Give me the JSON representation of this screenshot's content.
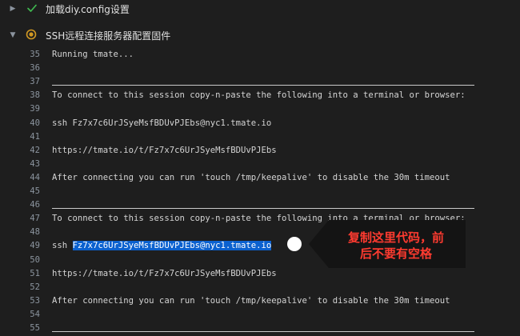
{
  "steps": [
    {
      "title": "加载diy.config设置",
      "status": "success",
      "icon": "check-icon"
    },
    {
      "title": "SSH远程连接服务器配置固件",
      "status": "running",
      "icon": "running-icon"
    }
  ],
  "log_lines": [
    {
      "n": "35",
      "text": "Running tmate..."
    },
    {
      "n": "36",
      "text": ""
    },
    {
      "n": "37",
      "text": "",
      "rule": true
    },
    {
      "n": "38",
      "text": "To connect to this session copy-n-paste the following into a terminal or browser:"
    },
    {
      "n": "39",
      "text": ""
    },
    {
      "n": "40",
      "text": "ssh Fz7x7c6UrJSyeMsfBDUvPJEbs@nyc1.tmate.io"
    },
    {
      "n": "41",
      "text": ""
    },
    {
      "n": "42",
      "text": "https://tmate.io/t/Fz7x7c6UrJSyeMsfBDUvPJEbs"
    },
    {
      "n": "43",
      "text": ""
    },
    {
      "n": "44",
      "text": "After connecting you can run 'touch /tmp/keepalive' to disable the 30m timeout"
    },
    {
      "n": "45",
      "text": ""
    },
    {
      "n": "46",
      "text": "",
      "rule": true
    },
    {
      "n": "47",
      "text": "To connect to this session copy-n-paste the following into a terminal or browser:"
    },
    {
      "n": "48",
      "text": ""
    },
    {
      "n": "49",
      "prefix": "ssh ",
      "highlight": "Fz7x7c6UrJSyeMsfBDUvPJEbs@nyc1.tmate.io"
    },
    {
      "n": "50",
      "text": ""
    },
    {
      "n": "51",
      "text": "https://tmate.io/t/Fz7x7c6UrJSyeMsfBDUvPJEbs"
    },
    {
      "n": "52",
      "text": ""
    },
    {
      "n": "53",
      "text": "After connecting you can run 'touch /tmp/keepalive' to disable the 30m timeout"
    },
    {
      "n": "54",
      "text": ""
    },
    {
      "n": "55",
      "text": "",
      "rule": true
    }
  ],
  "callout": {
    "line1": "复制这里代码，前",
    "line2": "后不要有空格"
  },
  "colors": {
    "background": "#1e1e1e",
    "success": "#3fb950",
    "running": "#d29922",
    "selection": "#0b61cf",
    "callout_bg": "#141414",
    "callout_text": "#ff3b30"
  }
}
